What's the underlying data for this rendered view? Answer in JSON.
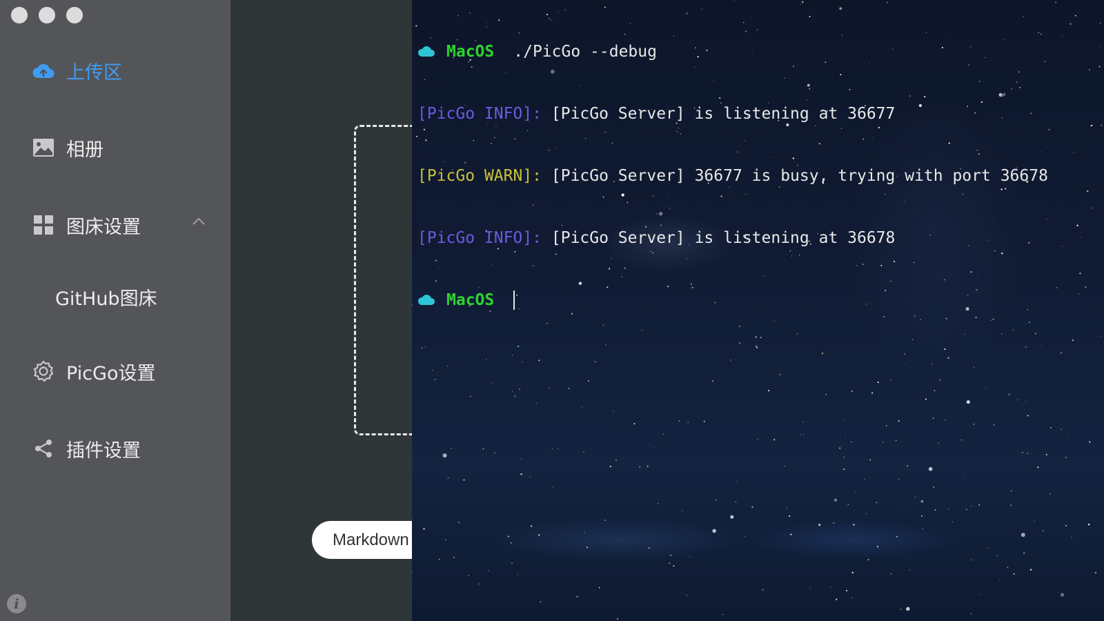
{
  "picgo": {
    "sidebar": {
      "items": [
        {
          "label": "上传区",
          "icon": "cloud-upload-icon",
          "active": true
        },
        {
          "label": "相册",
          "icon": "image-icon"
        },
        {
          "label": "图床设置",
          "icon": "grid-icon",
          "expanded": true
        },
        {
          "label": "GitHub图床",
          "sub": true
        },
        {
          "label": "PicGo设置",
          "icon": "gear-icon"
        },
        {
          "label": "插件设置",
          "icon": "share-icon"
        }
      ],
      "info_glyph": "i"
    },
    "main": {
      "markdown_button": "Markdown"
    }
  },
  "terminal": {
    "lines": [
      {
        "host": "MacOS",
        "command": "./PicGo --debug"
      },
      {
        "tag": "[PicGo INFO]:",
        "level": "info",
        "message": "[PicGo Server] is listening at 36677"
      },
      {
        "tag": "[PicGo WARN]:",
        "level": "warn",
        "message": "[PicGo Server] 36677 is busy, trying with port 36678"
      },
      {
        "tag": "[PicGo INFO]:",
        "level": "info",
        "message": "[PicGo Server] is listening at 36678"
      },
      {
        "host": "MacOS",
        "command": ""
      }
    ]
  },
  "colors": {
    "accent": "#3f9cf4",
    "sidebar_bg": "#545558",
    "main_bg": "#2f3638",
    "terminal_host": "#2fd42f",
    "terminal_info": "#6a5be0",
    "terminal_warn": "#c8c13a"
  }
}
